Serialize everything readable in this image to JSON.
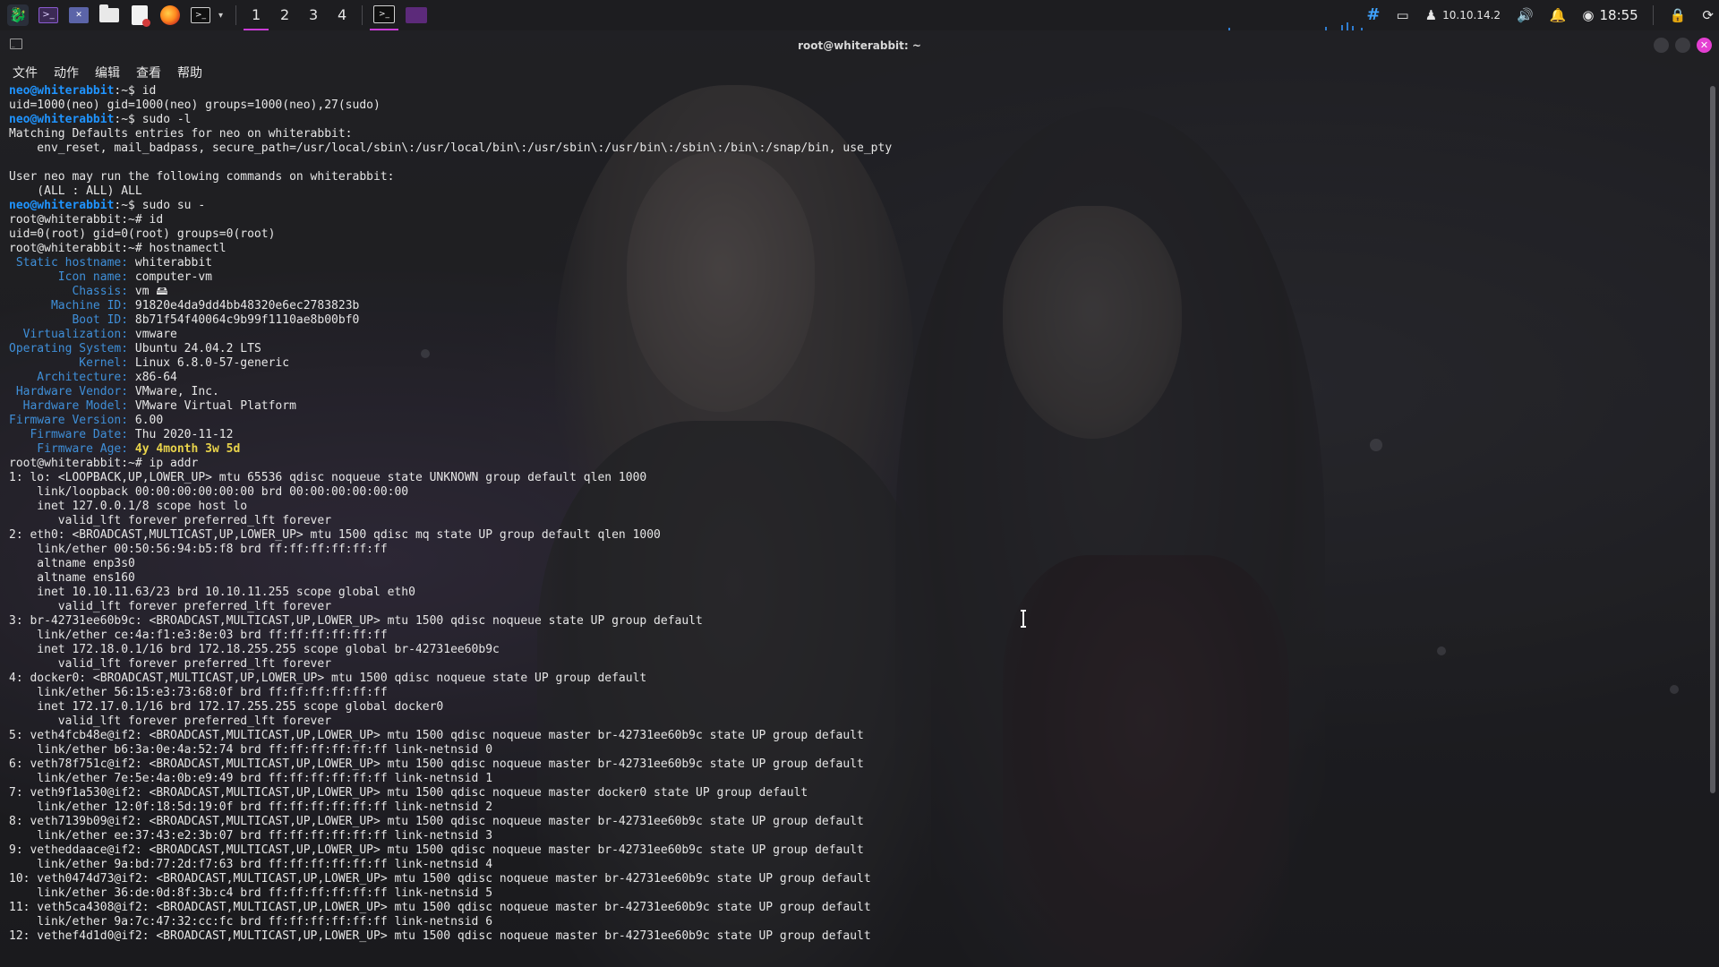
{
  "panel": {
    "workspaces": [
      "1",
      "2",
      "3",
      "4"
    ],
    "active_workspace": "1",
    "ip_address": "10.10.14.2",
    "clock": "18:55",
    "accent": "#c93bd6",
    "icons": [
      "kali-menu-icon",
      "terminal-icon",
      "window-switcher-icon",
      "files-icon",
      "text-editor-icon",
      "firefox-icon",
      "terminal-launcher-icon",
      "chevron-down-icon",
      "network-grid-icon",
      "display-icon",
      "vpn-user-icon",
      "volume-icon",
      "notification-bell-icon",
      "power-icon",
      "lock-icon",
      "restart-icon"
    ]
  },
  "window": {
    "title": "root@whiterabbit: ~",
    "menu": [
      "文件",
      "动作",
      "编辑",
      "查看",
      "帮助"
    ],
    "close_color": "#e43fd2"
  },
  "terminal": {
    "colors": {
      "prompt": "#1f94ff",
      "key": "#3f8fd8",
      "highlight": "#e8d34b",
      "text": "#e6e6e6"
    },
    "lines": [
      {
        "type": "prompt",
        "user": "neo@whiterabbit",
        "sep": ":~$ ",
        "cmd": "id"
      },
      {
        "type": "out",
        "text": "uid=1000(neo) gid=1000(neo) groups=1000(neo),27(sudo)"
      },
      {
        "type": "prompt",
        "user": "neo@whiterabbit",
        "sep": ":~$ ",
        "cmd": "sudo -l"
      },
      {
        "type": "out",
        "text": "Matching Defaults entries for neo on whiterabbit:"
      },
      {
        "type": "out",
        "text": "    env_reset, mail_badpass, secure_path=/usr/local/sbin\\:/usr/local/bin\\:/usr/sbin\\:/usr/bin\\:/sbin\\:/bin\\:/snap/bin, use_pty"
      },
      {
        "type": "out",
        "text": ""
      },
      {
        "type": "out",
        "text": "User neo may run the following commands on whiterabbit:"
      },
      {
        "type": "out",
        "text": "    (ALL : ALL) ALL"
      },
      {
        "type": "prompt",
        "user": "neo@whiterabbit",
        "sep": ":~$ ",
        "cmd": "sudo su -"
      },
      {
        "type": "out",
        "text": "root@whiterabbit:~# id"
      },
      {
        "type": "out",
        "text": "uid=0(root) gid=0(root) groups=0(root)"
      },
      {
        "type": "out",
        "text": "root@whiterabbit:~# hostnamectl"
      },
      {
        "type": "kv",
        "key": " Static hostname:",
        "val": " whiterabbit"
      },
      {
        "type": "kv",
        "key": "       Icon name:",
        "val": " computer-vm"
      },
      {
        "type": "kv",
        "key": "         Chassis:",
        "val": " vm 🖴"
      },
      {
        "type": "kv",
        "key": "      Machine ID:",
        "val": " 91820e4da9dd4bb48320e6ec2783823b"
      },
      {
        "type": "kv",
        "key": "         Boot ID:",
        "val": " 8b71f54f40064c9b99f1110ae8b00bf0"
      },
      {
        "type": "kv",
        "key": "  Virtualization:",
        "val": " vmware"
      },
      {
        "type": "kv",
        "key": "Operating System:",
        "val": " Ubuntu 24.04.2 LTS"
      },
      {
        "type": "kv",
        "key": "          Kernel:",
        "val": " Linux 6.8.0-57-generic"
      },
      {
        "type": "kv",
        "key": "    Architecture:",
        "val": " x86-64"
      },
      {
        "type": "kv",
        "key": " Hardware Vendor:",
        "val": " VMware, Inc."
      },
      {
        "type": "kv",
        "key": "  Hardware Model:",
        "val": " VMware Virtual Platform"
      },
      {
        "type": "kv",
        "key": "Firmware Version:",
        "val": " 6.00"
      },
      {
        "type": "kv",
        "key": "   Firmware Date:",
        "val": " Thu 2020-11-12"
      },
      {
        "type": "kvh",
        "key": "    Firmware Age:",
        "val": " 4y 4month 3w 5d"
      },
      {
        "type": "out",
        "text": "root@whiterabbit:~# ip addr"
      },
      {
        "type": "out",
        "text": "1: lo: <LOOPBACK,UP,LOWER_UP> mtu 65536 qdisc noqueue state UNKNOWN group default qlen 1000"
      },
      {
        "type": "out",
        "text": "    link/loopback 00:00:00:00:00:00 brd 00:00:00:00:00:00"
      },
      {
        "type": "out",
        "text": "    inet 127.0.0.1/8 scope host lo"
      },
      {
        "type": "out",
        "text": "       valid_lft forever preferred_lft forever"
      },
      {
        "type": "out",
        "text": "2: eth0: <BROADCAST,MULTICAST,UP,LOWER_UP> mtu 1500 qdisc mq state UP group default qlen 1000"
      },
      {
        "type": "out",
        "text": "    link/ether 00:50:56:94:b5:f8 brd ff:ff:ff:ff:ff:ff"
      },
      {
        "type": "out",
        "text": "    altname enp3s0"
      },
      {
        "type": "out",
        "text": "    altname ens160"
      },
      {
        "type": "out",
        "text": "    inet 10.10.11.63/23 brd 10.10.11.255 scope global eth0"
      },
      {
        "type": "out",
        "text": "       valid_lft forever preferred_lft forever"
      },
      {
        "type": "out",
        "text": "3: br-42731ee60b9c: <BROADCAST,MULTICAST,UP,LOWER_UP> mtu 1500 qdisc noqueue state UP group default"
      },
      {
        "type": "out",
        "text": "    link/ether ce:4a:f1:e3:8e:03 brd ff:ff:ff:ff:ff:ff"
      },
      {
        "type": "out",
        "text": "    inet 172.18.0.1/16 brd 172.18.255.255 scope global br-42731ee60b9c"
      },
      {
        "type": "out",
        "text": "       valid_lft forever preferred_lft forever"
      },
      {
        "type": "out",
        "text": "4: docker0: <BROADCAST,MULTICAST,UP,LOWER_UP> mtu 1500 qdisc noqueue state UP group default"
      },
      {
        "type": "out",
        "text": "    link/ether 56:15:e3:73:68:0f brd ff:ff:ff:ff:ff:ff"
      },
      {
        "type": "out",
        "text": "    inet 172.17.0.1/16 brd 172.17.255.255 scope global docker0"
      },
      {
        "type": "out",
        "text": "       valid_lft forever preferred_lft forever"
      },
      {
        "type": "out",
        "text": "5: veth4fcb48e@if2: <BROADCAST,MULTICAST,UP,LOWER_UP> mtu 1500 qdisc noqueue master br-42731ee60b9c state UP group default"
      },
      {
        "type": "out",
        "text": "    link/ether b6:3a:0e:4a:52:74 brd ff:ff:ff:ff:ff:ff link-netnsid 0"
      },
      {
        "type": "out",
        "text": "6: veth78f751c@if2: <BROADCAST,MULTICAST,UP,LOWER_UP> mtu 1500 qdisc noqueue master br-42731ee60b9c state UP group default"
      },
      {
        "type": "out",
        "text": "    link/ether 7e:5e:4a:0b:e9:49 brd ff:ff:ff:ff:ff:ff link-netnsid 1"
      },
      {
        "type": "out",
        "text": "7: veth9f1a530@if2: <BROADCAST,MULTICAST,UP,LOWER_UP> mtu 1500 qdisc noqueue master docker0 state UP group default"
      },
      {
        "type": "out",
        "text": "    link/ether 12:0f:18:5d:19:0f brd ff:ff:ff:ff:ff:ff link-netnsid 2"
      },
      {
        "type": "out",
        "text": "8: veth7139b09@if2: <BROADCAST,MULTICAST,UP,LOWER_UP> mtu 1500 qdisc noqueue master br-42731ee60b9c state UP group default"
      },
      {
        "type": "out",
        "text": "    link/ether ee:37:43:e2:3b:07 brd ff:ff:ff:ff:ff:ff link-netnsid 3"
      },
      {
        "type": "out",
        "text": "9: vetheddaace@if2: <BROADCAST,MULTICAST,UP,LOWER_UP> mtu 1500 qdisc noqueue master br-42731ee60b9c state UP group default"
      },
      {
        "type": "out",
        "text": "    link/ether 9a:bd:77:2d:f7:63 brd ff:ff:ff:ff:ff:ff link-netnsid 4"
      },
      {
        "type": "out",
        "text": "10: veth0474d73@if2: <BROADCAST,MULTICAST,UP,LOWER_UP> mtu 1500 qdisc noqueue master br-42731ee60b9c state UP group default"
      },
      {
        "type": "out",
        "text": "    link/ether 36:de:0d:8f:3b:c4 brd ff:ff:ff:ff:ff:ff link-netnsid 5"
      },
      {
        "type": "out",
        "text": "11: veth5ca4308@if2: <BROADCAST,MULTICAST,UP,LOWER_UP> mtu 1500 qdisc noqueue master br-42731ee60b9c state UP group default"
      },
      {
        "type": "out",
        "text": "    link/ether 9a:7c:47:32:cc:fc brd ff:ff:ff:ff:ff:ff link-netnsid 6"
      },
      {
        "type": "out",
        "text": "12: vethef4d1d0@if2: <BROADCAST,MULTICAST,UP,LOWER_UP> mtu 1500 qdisc noqueue master br-42731ee60b9c state UP group default"
      }
    ]
  }
}
